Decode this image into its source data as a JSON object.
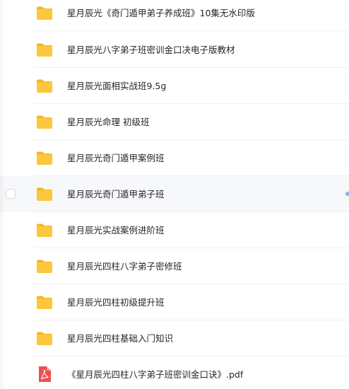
{
  "files": [
    {
      "name": "星月辰光《奇门遁甲弟子养成班》10集无水印版",
      "type": "folder",
      "icon": "folder-icon"
    },
    {
      "name": "星月辰光八字弟子班密训金口决电子版教材",
      "type": "folder",
      "icon": "folder-icon"
    },
    {
      "name": "星月辰光面相实战班9.5g",
      "type": "folder",
      "icon": "folder-icon"
    },
    {
      "name": "星月辰光命理 初级班",
      "type": "folder",
      "icon": "folder-icon"
    },
    {
      "name": "星月辰光奇门遁甲案例班",
      "type": "folder",
      "icon": "folder-icon"
    },
    {
      "name": "星月辰光奇门遁甲弟子班",
      "type": "folder",
      "icon": "folder-icon",
      "hovered": true
    },
    {
      "name": "星月辰光实战案例进阶班",
      "type": "folder",
      "icon": "folder-icon"
    },
    {
      "name": "星月辰光四柱八字弟子密修班",
      "type": "folder",
      "icon": "folder-icon"
    },
    {
      "name": "星月辰光四柱初级提升班",
      "type": "folder",
      "icon": "folder-icon"
    },
    {
      "name": "星月辰光四柱基础入门知识",
      "type": "folder",
      "icon": "folder-icon"
    },
    {
      "name": "《星月辰光四柱八字弟子班密训金口诀》.pdf",
      "type": "pdf",
      "icon": "pdf-icon"
    }
  ],
  "colors": {
    "folder": "#fcc73d",
    "folder_tab": "#f5b51e",
    "pdf": "#f04e4e",
    "text": "#25262b",
    "hover_bg": "#f7f8fa",
    "accent": "#8fb3e8"
  }
}
